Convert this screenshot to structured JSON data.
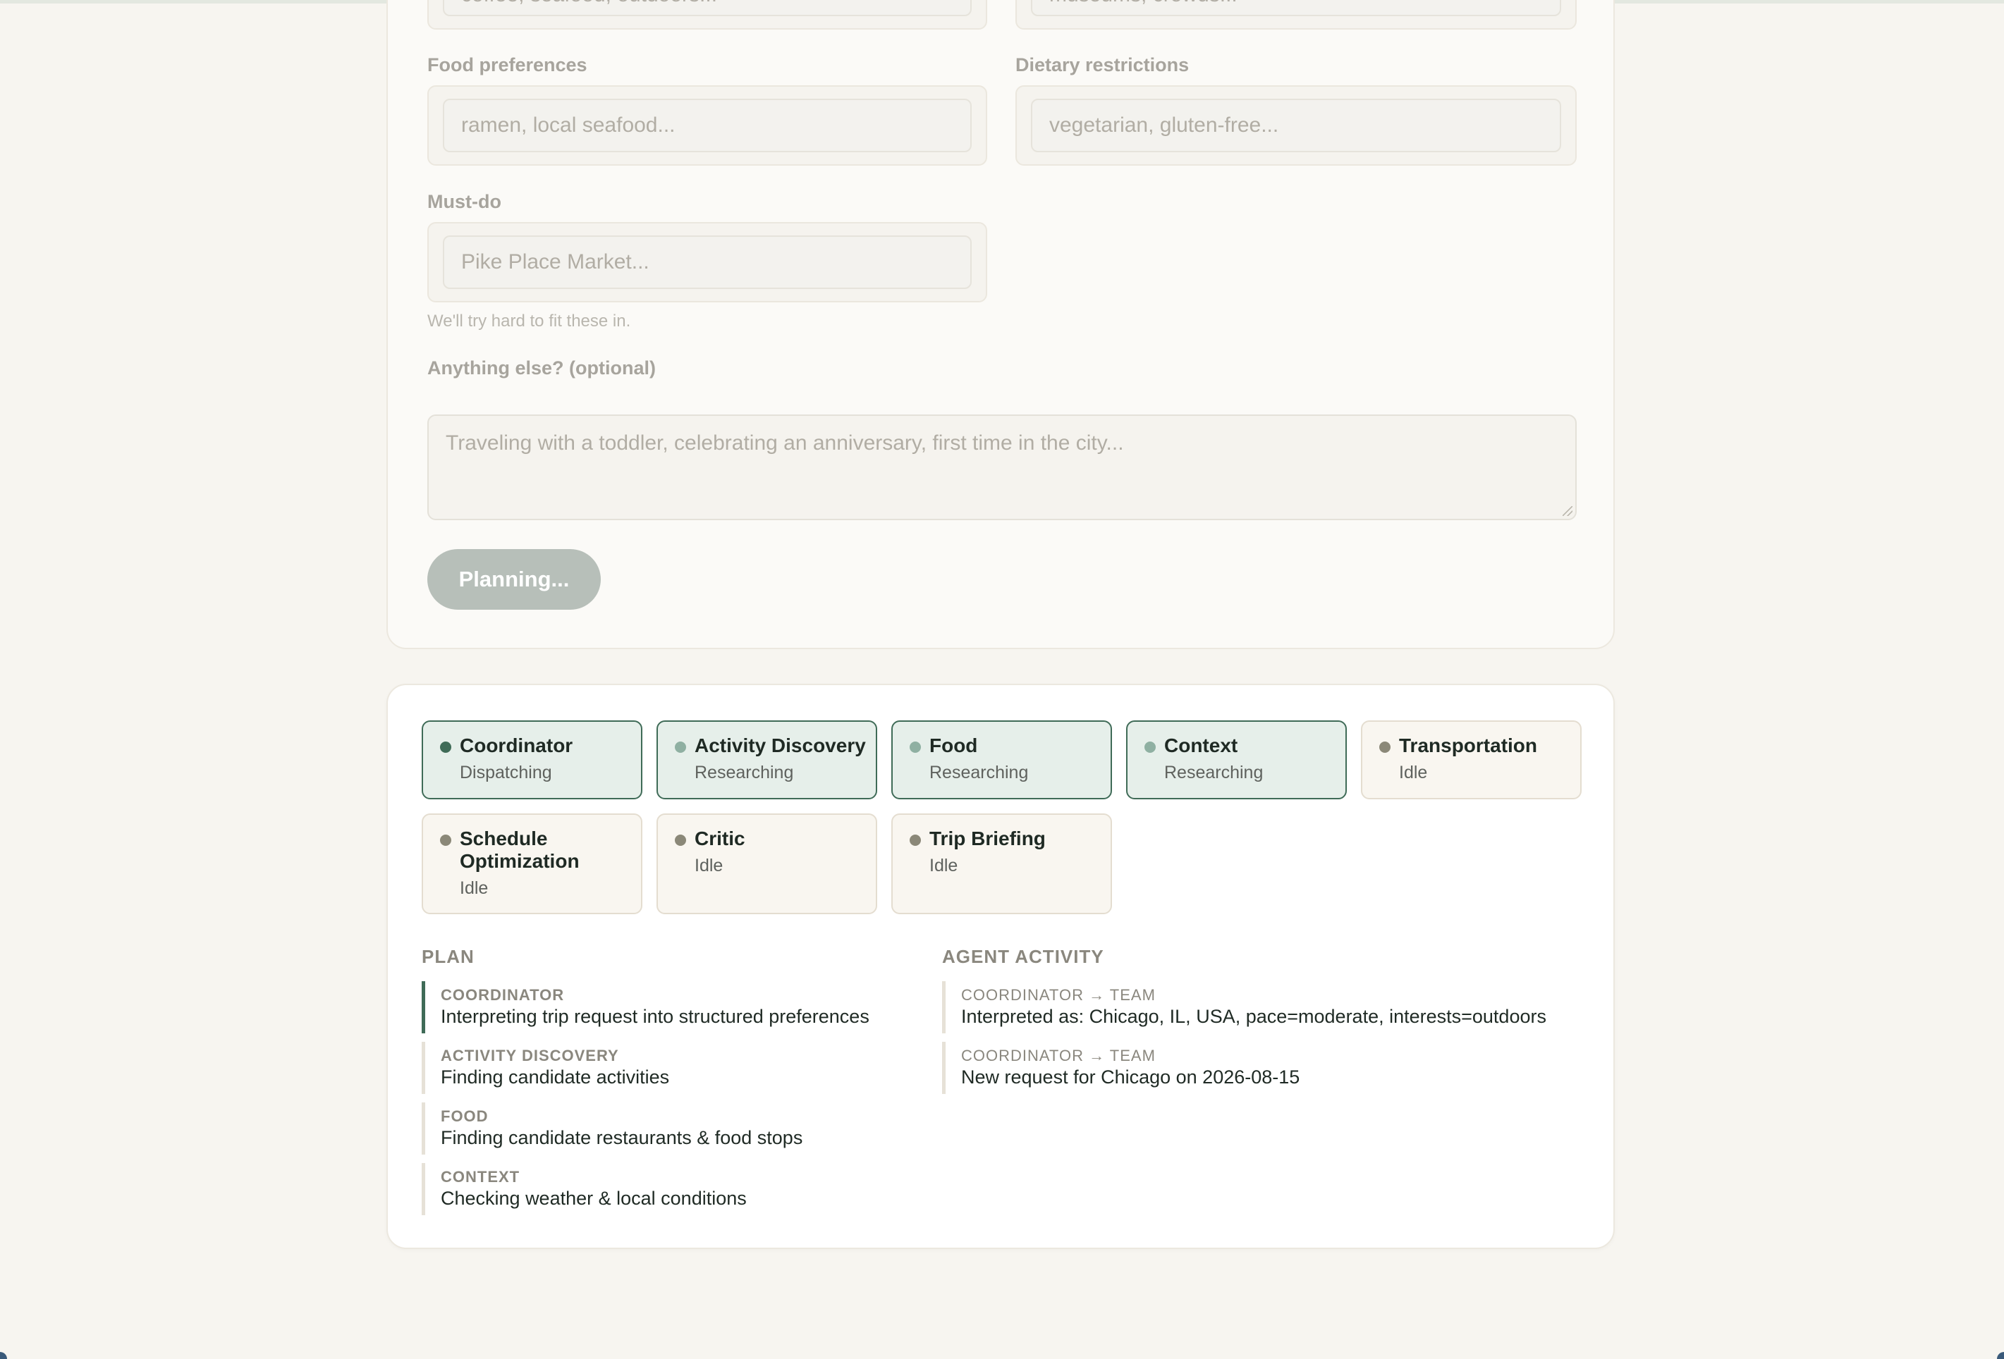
{
  "form": {
    "interests_placeholder": "coffee, seafood, outdoors...",
    "avoid_placeholder": "museums, crowds...",
    "food_label": "Food preferences",
    "food_placeholder": "ramen, local seafood...",
    "dietary_label": "Dietary restrictions",
    "dietary_placeholder": "vegetarian, gluten-free...",
    "mustdo_label": "Must-do",
    "mustdo_placeholder": "Pike Place Market...",
    "mustdo_hint": "We'll try hard to fit these in.",
    "notes_label": "Anything else? (optional)",
    "notes_placeholder": "Traveling with a toddler, celebrating an anniversary, first time in the city...",
    "submit_label": "Planning..."
  },
  "agents": [
    {
      "name": "Coordinator",
      "status": "Dispatching",
      "state": "lead"
    },
    {
      "name": "Activity Discovery",
      "status": "Researching",
      "state": "active"
    },
    {
      "name": "Food",
      "status": "Researching",
      "state": "active"
    },
    {
      "name": "Context",
      "status": "Researching",
      "state": "active"
    },
    {
      "name": "Transportation",
      "status": "Idle",
      "state": "idle"
    },
    {
      "name": "Schedule Optimization",
      "status": "Idle",
      "state": "idle"
    },
    {
      "name": "Critic",
      "status": "Idle",
      "state": "idle"
    },
    {
      "name": "Trip Briefing",
      "status": "Idle",
      "state": "idle"
    }
  ],
  "plan": {
    "title": "PLAN",
    "items": [
      {
        "agent": "COORDINATOR",
        "text": "Interpreting trip request into structured preferences"
      },
      {
        "agent": "ACTIVITY DISCOVERY",
        "text": "Finding candidate activities"
      },
      {
        "agent": "FOOD",
        "text": "Finding candidate restaurants & food stops"
      },
      {
        "agent": "CONTEXT",
        "text": "Checking weather & local conditions"
      }
    ]
  },
  "activity": {
    "title": "AGENT ACTIVITY",
    "items": [
      {
        "route": "COORDINATOR → TEAM",
        "text": "Interpreted as: Chicago, IL, USA, pace=moderate, interests=outdoors"
      },
      {
        "route": "COORDINATOR → TEAM",
        "text": "New request for Chicago on 2026-08-15"
      }
    ]
  },
  "colors": {
    "accent": "#3f6b57",
    "active_card_bg": "#e6efea",
    "idle_card_bg": "#f9f6f0",
    "page_bg": "#f7f5f0"
  }
}
